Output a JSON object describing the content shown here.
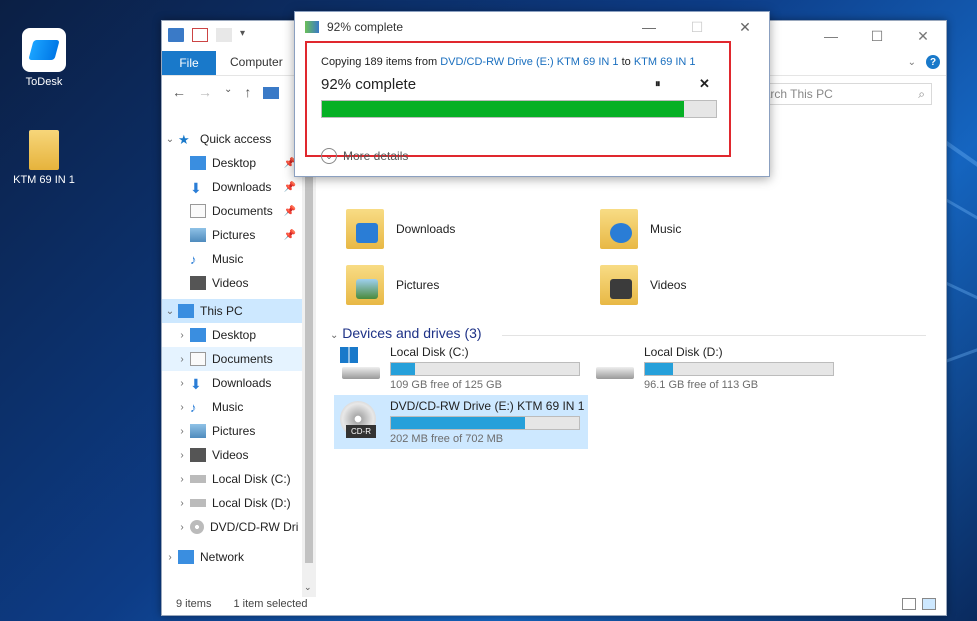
{
  "desktop": {
    "icons": [
      {
        "label": "ToDesk",
        "icon": "todesk-app-icon"
      },
      {
        "label": "KTM 69 IN 1",
        "icon": "folder-icon"
      }
    ]
  },
  "explorer": {
    "ribbon": {
      "file_tab": "File",
      "computer_tab": "Computer"
    },
    "search": {
      "placeholder": "Search This PC"
    },
    "sidebar": {
      "quick_access": "Quick access",
      "quick_items": [
        "Desktop",
        "Downloads",
        "Documents",
        "Pictures",
        "Music",
        "Videos"
      ],
      "this_pc": "This PC",
      "pc_items": [
        "Desktop",
        "Documents",
        "Downloads",
        "Music",
        "Pictures",
        "Videos",
        "Local Disk (C:)",
        "Local Disk (D:)",
        "DVD/CD-RW Dri"
      ],
      "network": "Network"
    },
    "folders": [
      "Downloads",
      "Music",
      "Pictures",
      "Videos"
    ],
    "devices_heading": "Devices and drives (3)",
    "drives": [
      {
        "name": "Local Disk (C:)",
        "free": "109 GB free of 125 GB",
        "used_fraction": 0.128
      },
      {
        "name": "Local Disk (D:)",
        "free": "96.1 GB free of 113 GB",
        "used_fraction": 0.15
      },
      {
        "name": "DVD/CD-RW Drive (E:) KTM 69 IN 1",
        "free": "202 MB free of 702 MB",
        "used_fraction": 0.712,
        "badge": "CD-R"
      }
    ],
    "status": {
      "items": "9 items",
      "selected": "1 item selected"
    },
    "colors": {
      "accent": "#1979ca",
      "bar": "#26a0da",
      "selected": "#cde8ff"
    }
  },
  "copy_dialog": {
    "title": "92% complete",
    "line_prefix": "Copying 189 items from",
    "source": "DVD/CD-RW Drive (E:) KTM 69 IN 1",
    "to_word": "to",
    "dest": "KTM 69 IN 1",
    "progress_text": "92% complete",
    "progress_fraction": 0.92,
    "pause_glyph": "⏸",
    "cancel_glyph": "✕",
    "more_details": "More details",
    "colors": {
      "progress": "#06b025",
      "highlight": "#e0282e",
      "link": "#1a6fbf"
    }
  }
}
